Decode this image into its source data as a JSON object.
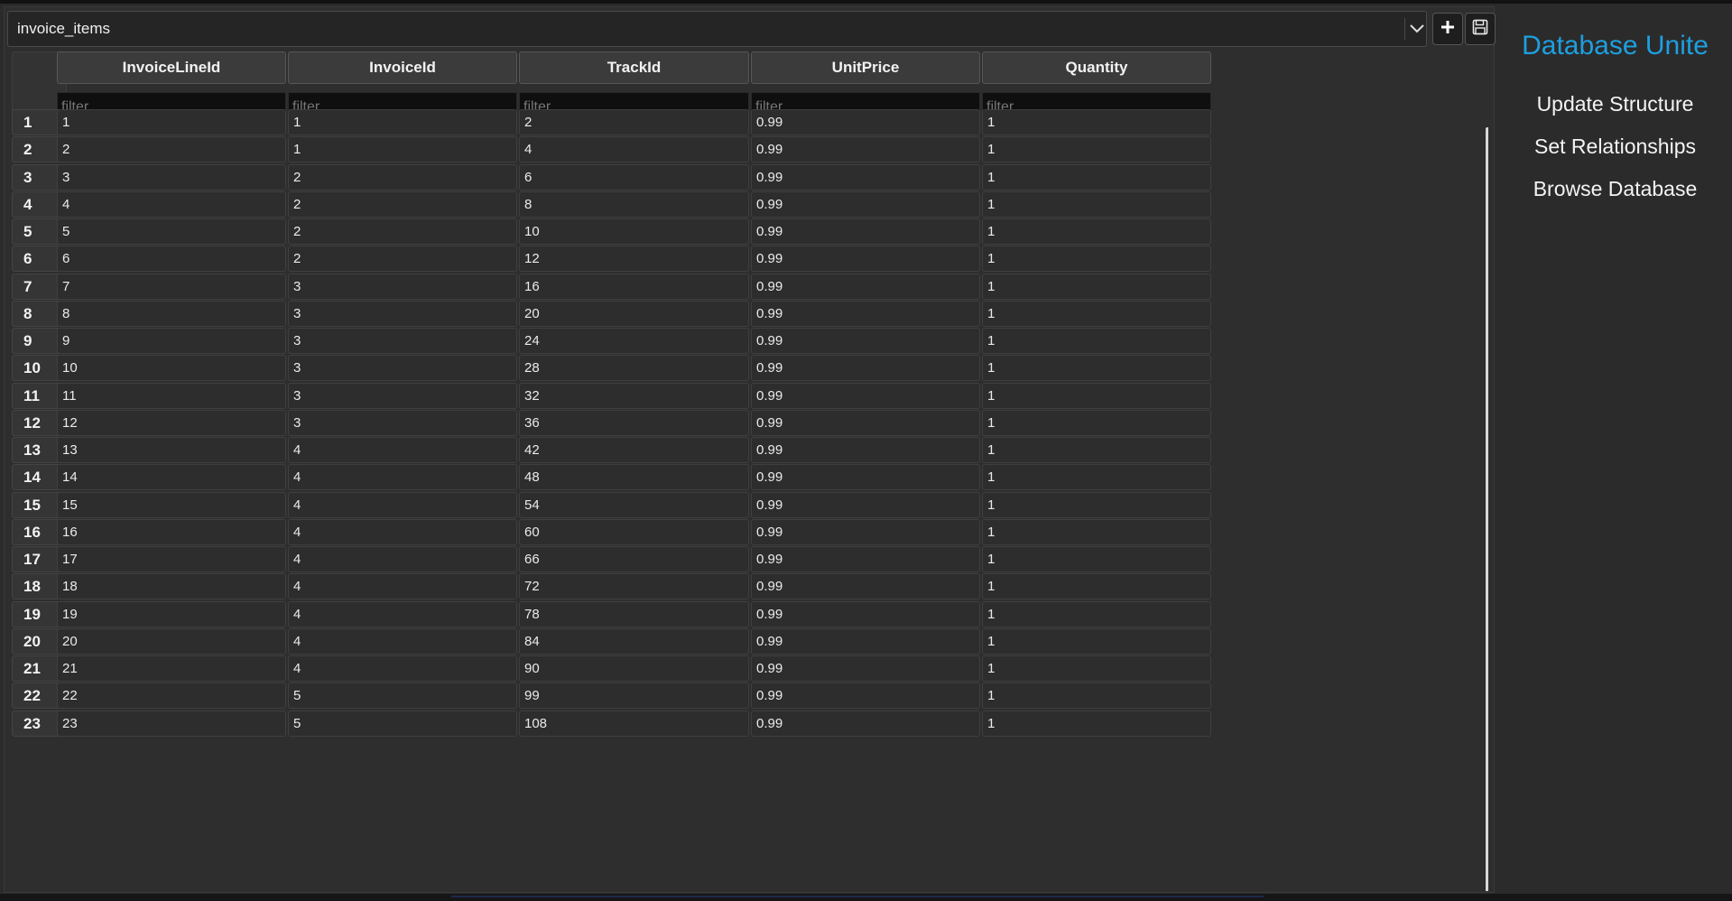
{
  "selector": {
    "current_table": "invoice_items"
  },
  "sidebar": {
    "brand": "Database Unite",
    "items": [
      {
        "label": "Update Structure"
      },
      {
        "label": "Set Relationships"
      },
      {
        "label": "Browse Database"
      }
    ]
  },
  "grid": {
    "columns": [
      {
        "header": "InvoiceLineId",
        "filter_placeholder": "filter"
      },
      {
        "header": "InvoiceId",
        "filter_placeholder": "filter"
      },
      {
        "header": "TrackId",
        "filter_placeholder": "filter"
      },
      {
        "header": "UnitPrice",
        "filter_placeholder": "filter"
      },
      {
        "header": "Quantity",
        "filter_placeholder": "filter"
      }
    ],
    "rows": [
      {
        "num": "1",
        "cells": [
          "1",
          "1",
          "2",
          "0.99",
          "1"
        ]
      },
      {
        "num": "2",
        "cells": [
          "2",
          "1",
          "4",
          "0.99",
          "1"
        ]
      },
      {
        "num": "3",
        "cells": [
          "3",
          "2",
          "6",
          "0.99",
          "1"
        ]
      },
      {
        "num": "4",
        "cells": [
          "4",
          "2",
          "8",
          "0.99",
          "1"
        ]
      },
      {
        "num": "5",
        "cells": [
          "5",
          "2",
          "10",
          "0.99",
          "1"
        ]
      },
      {
        "num": "6",
        "cells": [
          "6",
          "2",
          "12",
          "0.99",
          "1"
        ]
      },
      {
        "num": "7",
        "cells": [
          "7",
          "3",
          "16",
          "0.99",
          "1"
        ]
      },
      {
        "num": "8",
        "cells": [
          "8",
          "3",
          "20",
          "0.99",
          "1"
        ]
      },
      {
        "num": "9",
        "cells": [
          "9",
          "3",
          "24",
          "0.99",
          "1"
        ]
      },
      {
        "num": "10",
        "cells": [
          "10",
          "3",
          "28",
          "0.99",
          "1"
        ]
      },
      {
        "num": "11",
        "cells": [
          "11",
          "3",
          "32",
          "0.99",
          "1"
        ]
      },
      {
        "num": "12",
        "cells": [
          "12",
          "3",
          "36",
          "0.99",
          "1"
        ]
      },
      {
        "num": "13",
        "cells": [
          "13",
          "4",
          "42",
          "0.99",
          "1"
        ]
      },
      {
        "num": "14",
        "cells": [
          "14",
          "4",
          "48",
          "0.99",
          "1"
        ]
      },
      {
        "num": "15",
        "cells": [
          "15",
          "4",
          "54",
          "0.99",
          "1"
        ]
      },
      {
        "num": "16",
        "cells": [
          "16",
          "4",
          "60",
          "0.99",
          "1"
        ]
      },
      {
        "num": "17",
        "cells": [
          "17",
          "4",
          "66",
          "0.99",
          "1"
        ]
      },
      {
        "num": "18",
        "cells": [
          "18",
          "4",
          "72",
          "0.99",
          "1"
        ]
      },
      {
        "num": "19",
        "cells": [
          "19",
          "4",
          "78",
          "0.99",
          "1"
        ]
      },
      {
        "num": "20",
        "cells": [
          "20",
          "4",
          "84",
          "0.99",
          "1"
        ]
      },
      {
        "num": "21",
        "cells": [
          "21",
          "4",
          "90",
          "0.99",
          "1"
        ]
      },
      {
        "num": "22",
        "cells": [
          "22",
          "5",
          "99",
          "0.99",
          "1"
        ]
      },
      {
        "num": "23",
        "cells": [
          "23",
          "5",
          "108",
          "0.99",
          "1"
        ]
      }
    ]
  },
  "icons": {
    "dropdown": "chevron-down-icon",
    "add": "plus-icon",
    "save": "save-icon"
  },
  "colors": {
    "brand": "#1e9fe0",
    "background": "#2b2b2b",
    "filter_bg": "#0f0f0f"
  }
}
